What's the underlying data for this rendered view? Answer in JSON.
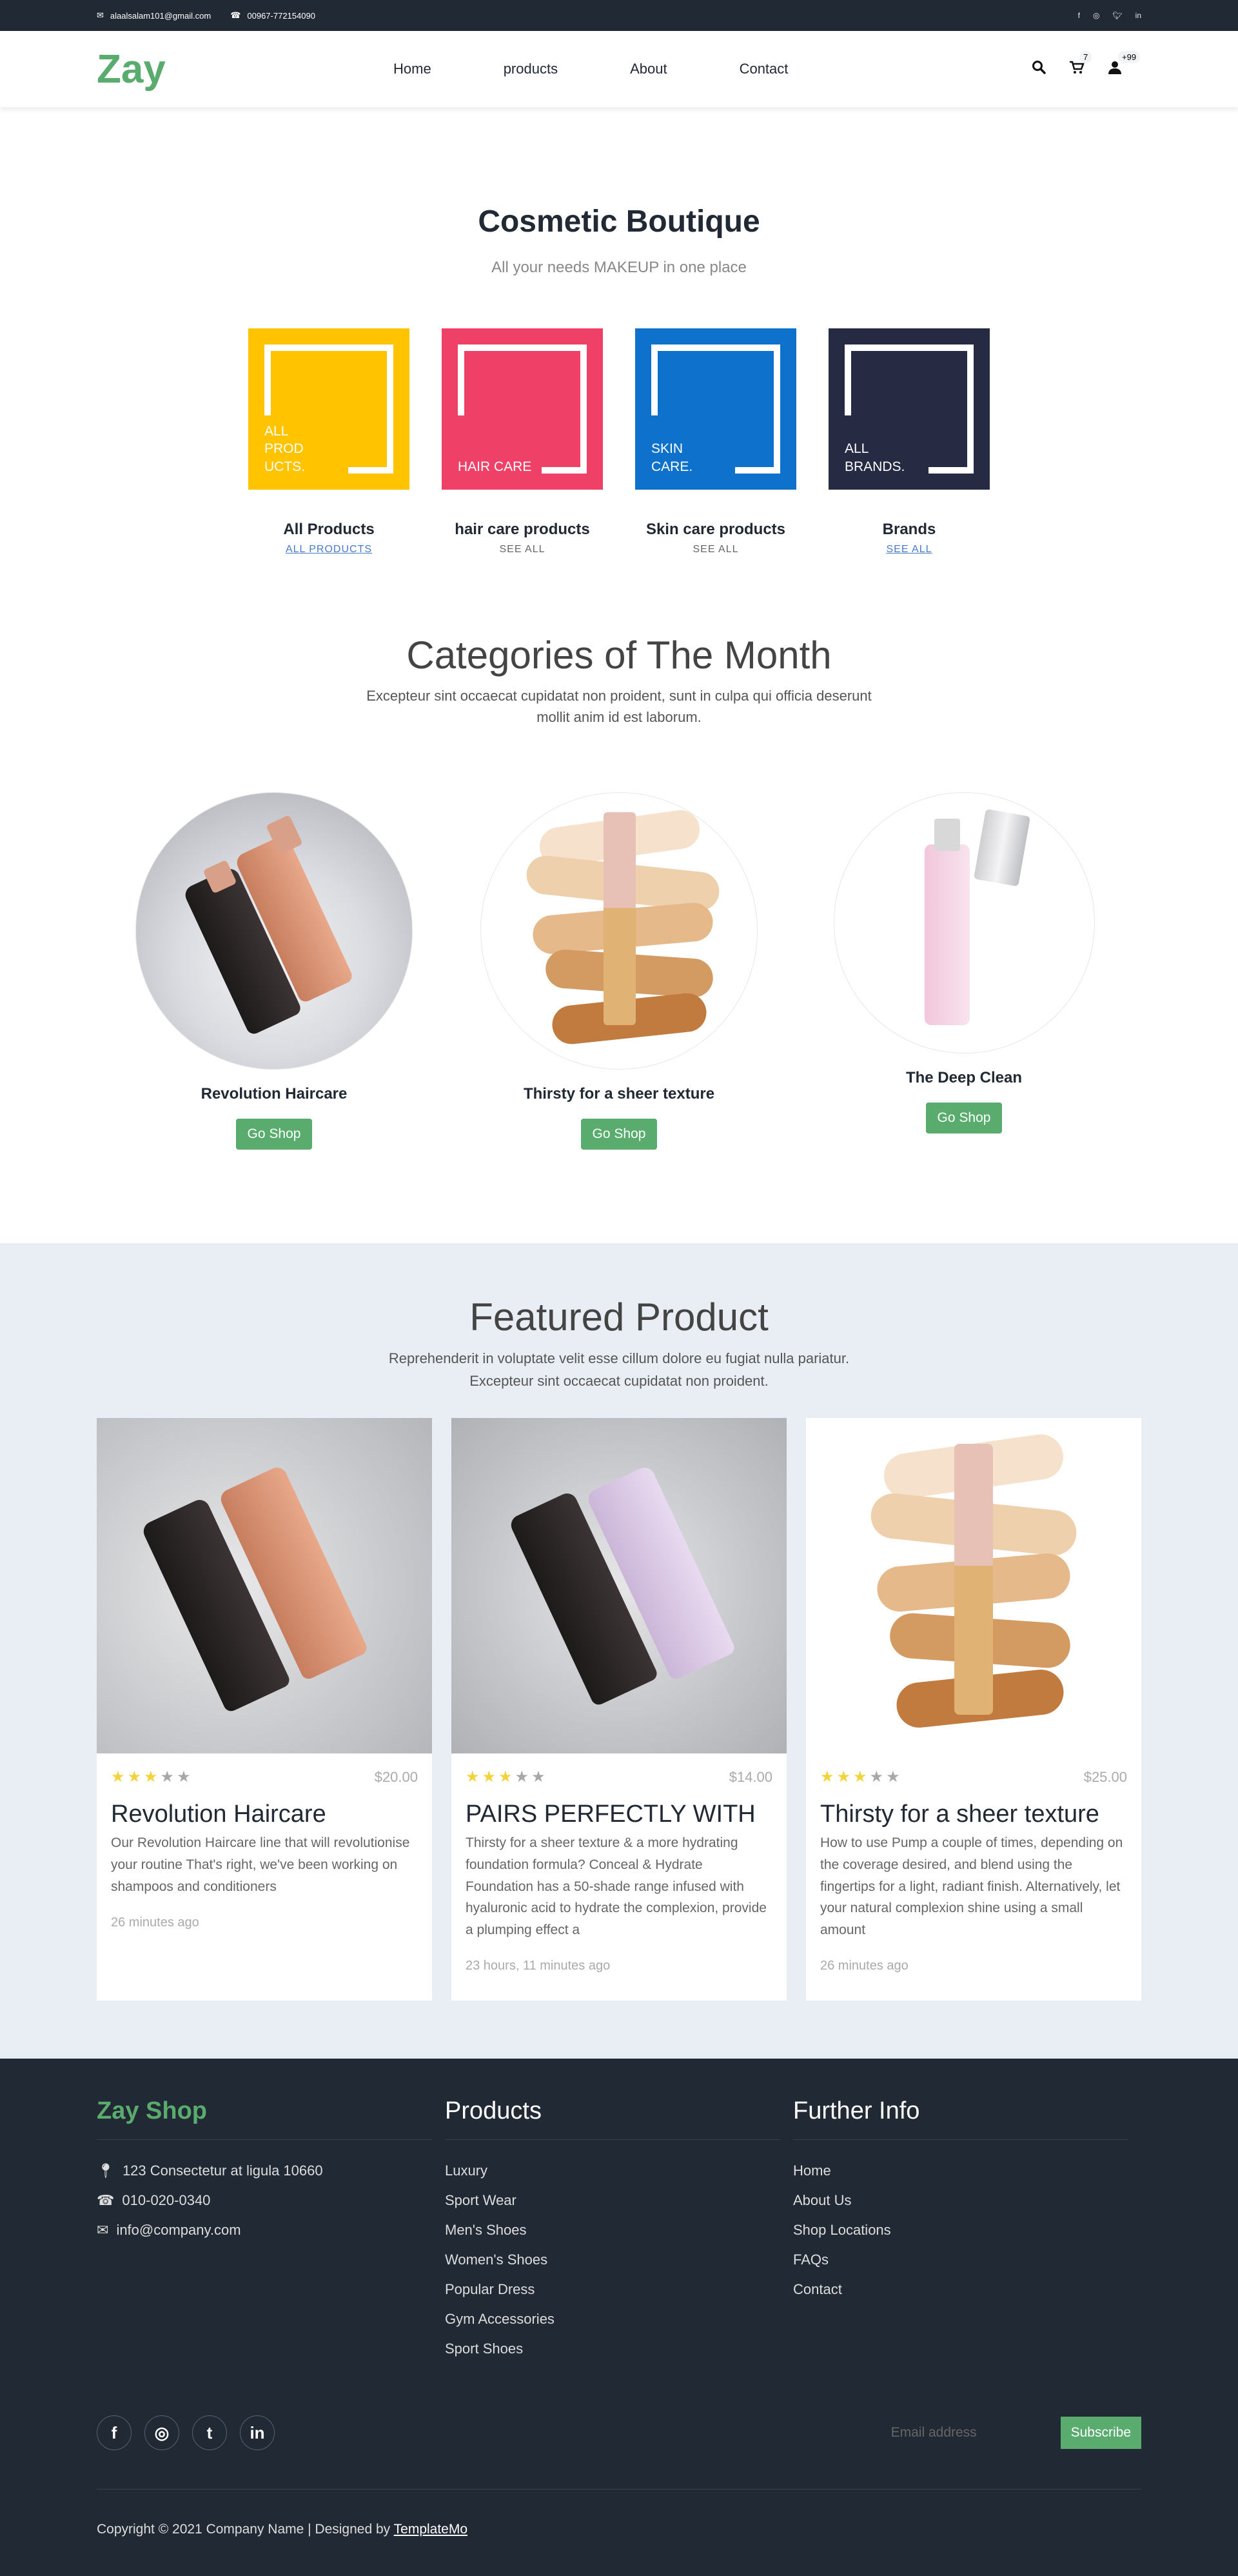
{
  "topbar": {
    "email": "alaalsalam101@gmail.com",
    "phone": "00967-772154090",
    "social_icons": [
      "facebook-icon",
      "instagram-icon",
      "twitter-icon",
      "linkedin-icon"
    ]
  },
  "nav": {
    "logo": "Zay",
    "menu": [
      "Home",
      "products",
      "About",
      "Contact"
    ],
    "cart_count": "7",
    "user_count": "+99"
  },
  "hero": {
    "title": "Cosmetic Boutique",
    "subtitle": "All your needs MAKEUP in one place"
  },
  "tiles": [
    {
      "label_lines": [
        "ALL",
        "PROD",
        "UCTS."
      ],
      "title": "All Products",
      "link": "ALL PRODUCTS",
      "color": "#ffc300",
      "link_style": "underline"
    },
    {
      "label_lines": [
        "HAIR CARE"
      ],
      "title": "hair care products",
      "link": "SEE ALL",
      "color": "#ef4167",
      "link_style": "plain"
    },
    {
      "label_lines": [
        "SKIN",
        "CARE."
      ],
      "title": "Skin care products",
      "link": "SEE ALL",
      "color": "#0e72cc",
      "link_style": "plain"
    },
    {
      "label_lines": [
        "ALL",
        "BRANDS."
      ],
      "title": "Brands",
      "link": "SEE ALL",
      "color": "#262a42",
      "link_style": "underline"
    }
  ],
  "categories": {
    "title": "Categories of The Month",
    "subtitle": "Excepteur sint occaecat cupidatat non proident, sunt in culpa qui officia deserunt mollit anim id est laborum.",
    "items": [
      {
        "name": "Revolution Haircare",
        "button": "Go Shop"
      },
      {
        "name": "Thirsty for a sheer texture",
        "button": "Go Shop"
      },
      {
        "name": "The Deep Clean",
        "button": "Go Shop"
      }
    ]
  },
  "featured": {
    "title": "Featured Product",
    "subtitle_line1": "Reprehenderit in voluptate velit esse cillum dolore eu fugiat nulla pariatur.",
    "subtitle_line2": "Excepteur sint occaecat cupidatat non proident.",
    "products": [
      {
        "rating": 3,
        "price": "$20.00",
        "name": "Revolution Haircare",
        "description": "Our Revolution Haircare line that will revolutionise your routine That's right, we've been working on shampoos and conditioners",
        "time": "26 minutes ago"
      },
      {
        "rating": 3,
        "price": "$14.00",
        "name": "PAIRS PERFECTLY WITH",
        "description": "Thirsty for a sheer texture & a more hydrating foundation formula? Conceal & Hydrate Foundation has a 50-shade range infused with hyaluronic acid to hydrate the complexion, provide a plumping effect a",
        "time": "23 hours, 11 minutes ago"
      },
      {
        "rating": 3,
        "price": "$25.00",
        "name": "Thirsty for a sheer texture",
        "description": "How to use Pump a couple of times, depending on the coverage desired, and blend using the fingertips for a light, radiant finish. Alternatively, let your natural complexion shine using a small amount",
        "time": "26 minutes ago"
      }
    ]
  },
  "footer": {
    "brand": "Zay Shop",
    "address": "123 Consectetur at ligula 10660",
    "phone": "010-020-0340",
    "email": "info@company.com",
    "products_title": "Products",
    "products": [
      "Luxury",
      "Sport Wear",
      "Men's Shoes",
      "Women's Shoes",
      "Popular Dress",
      "Gym Accessories",
      "Sport Shoes"
    ],
    "info_title": "Further Info",
    "info": [
      "Home",
      "About Us",
      "Shop Locations",
      "FAQs",
      "Contact"
    ],
    "social_icons": [
      "facebook-icon",
      "instagram-icon",
      "twitter-icon",
      "linkedin-icon"
    ],
    "email_placeholder": "Email address",
    "subscribe": "Subscribe",
    "copyright": "Copyright © 2021 Company Name | Designed by",
    "designer": "TemplateMo"
  },
  "colors": {
    "accent": "#59ab6e",
    "dark": "#212934",
    "star": "#f2d33a"
  }
}
